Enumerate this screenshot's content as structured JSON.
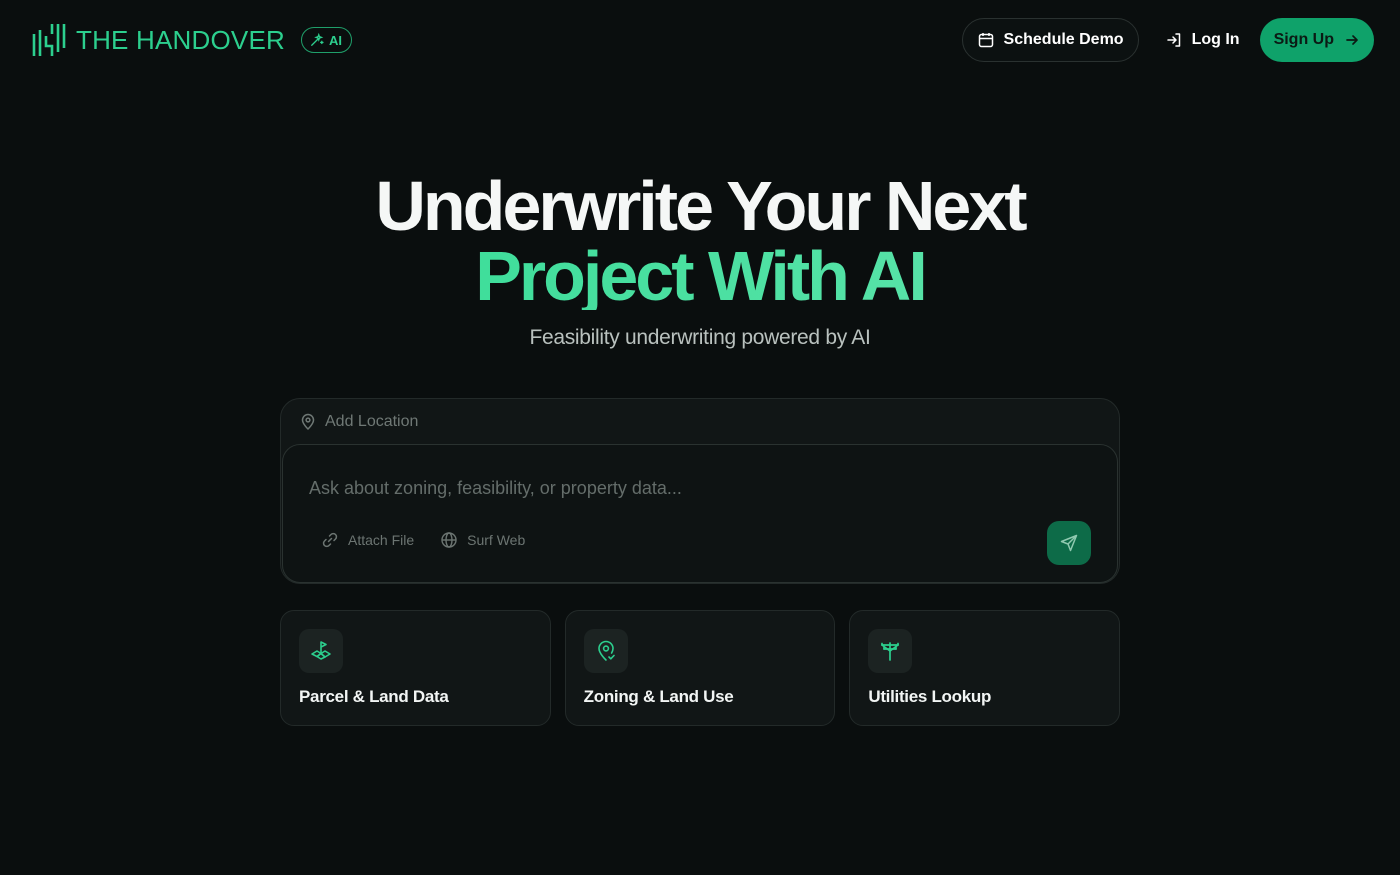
{
  "header": {
    "brand_name": "THE HANDOVER",
    "ai_badge": "AI",
    "schedule_demo_label": "Schedule Demo",
    "login_label": "Log In",
    "signup_label": "Sign Up"
  },
  "hero": {
    "title_line1": "Underwrite Your Next",
    "title_line2": "Project With AI",
    "subtitle": "Feasibility underwriting powered by AI"
  },
  "prompt": {
    "location_placeholder": "Add Location",
    "input_placeholder": "Ask about zoning, feasibility, or property data...",
    "input_value": "",
    "tools": {
      "attach_label": "Attach File",
      "web_label": "Surf Web"
    }
  },
  "cards": [
    {
      "label": "Parcel & Land Data",
      "icon": "parcel-icon"
    },
    {
      "label": "Zoning & Land Use",
      "icon": "zoning-pin-icon"
    },
    {
      "label": "Utilities Lookup",
      "icon": "utility-pole-icon"
    }
  ],
  "colors": {
    "background": "#0a0e0e",
    "accent": "#2ccf8e",
    "signup_bg": "#0fa26a",
    "send_bg": "#0d6b48",
    "card_bg": "#111616"
  }
}
